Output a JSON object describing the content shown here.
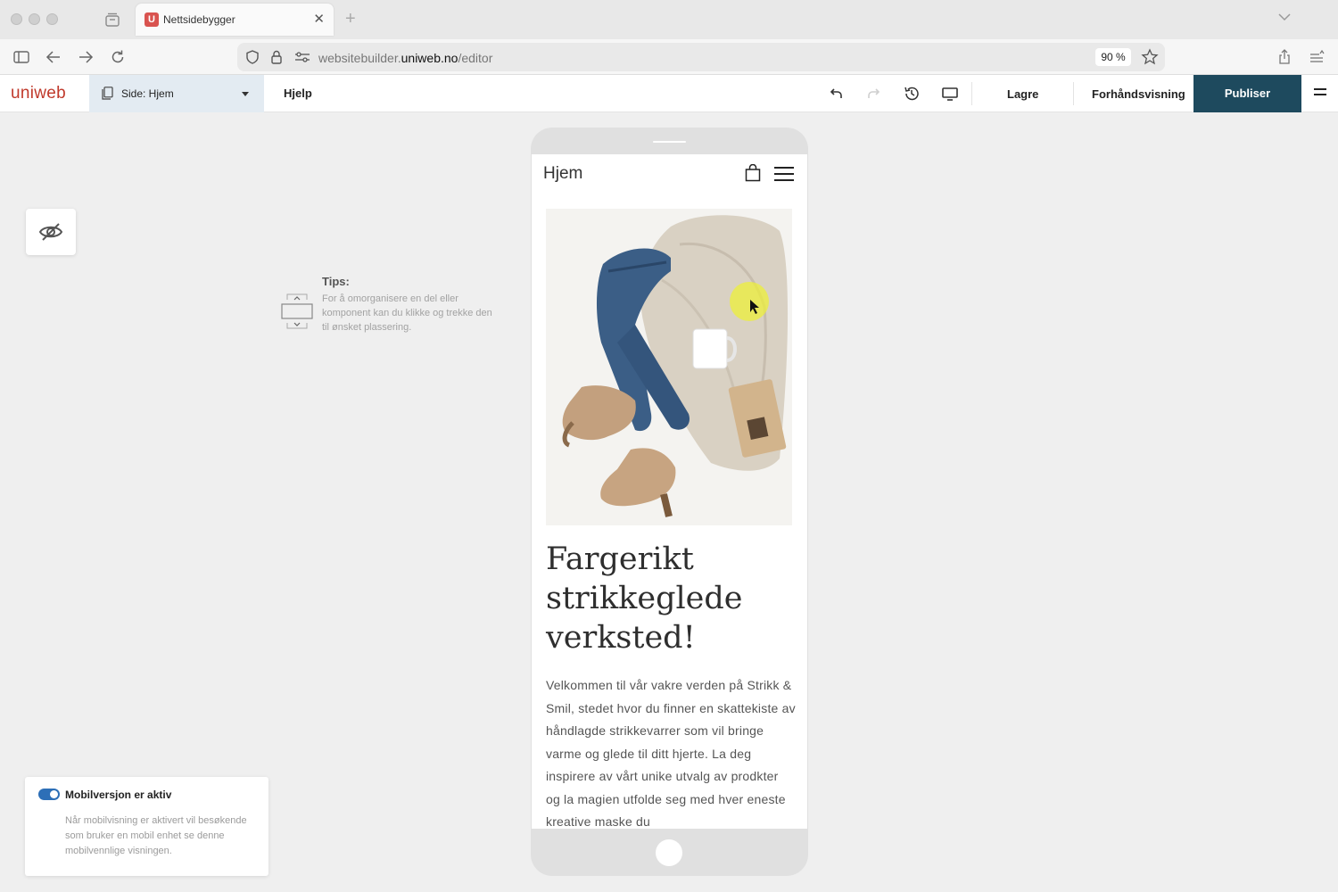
{
  "browser": {
    "tab_title": "Nettsidebygger",
    "tab_favicon": "U",
    "url_prefix": "websitebuilder.",
    "url_domain": "uniweb.no",
    "url_path": "/editor",
    "zoom": "90 %"
  },
  "editor": {
    "logo": "uniweb",
    "page_select_label": "Side: Hjem",
    "help": "Hjelp",
    "save": "Lagre",
    "preview": "Forhåndsvisning",
    "publish": "Publiser"
  },
  "tips": {
    "title": "Tips:",
    "text": "For å omorganisere en del eller komponent kan du klikke og trekke den til ønsket plassering."
  },
  "mobile_notice": {
    "title": "Mobilversjon er aktiv",
    "text": "Når mobilvisning er aktivert vil besøkende som bruker en mobil enhet se denne mobilvennlige visningen.",
    "enabled": true,
    "toggle_color": "#2d6fb7"
  },
  "site": {
    "title": "Hjem",
    "headline": "Fargerikt strikkeglede verksted!",
    "body": "Velkommen til vår vakre verden på Strikk & Smil, stedet hvor du finner en skattekiste av håndlagde strikkevarrer som vil bringe varme og glede til ditt hjerte. La deg inspirere av vårt unike utvalg av prodkter og la magien utfolde seg med hver eneste kreative maske du",
    "hero_image": "flatlay-jeans-sweater-boots-mug-photo"
  },
  "colors": {
    "brand": "#c0392b",
    "publish_bg": "#1e4a5e",
    "page_select_bg": "#e3ebf2"
  }
}
